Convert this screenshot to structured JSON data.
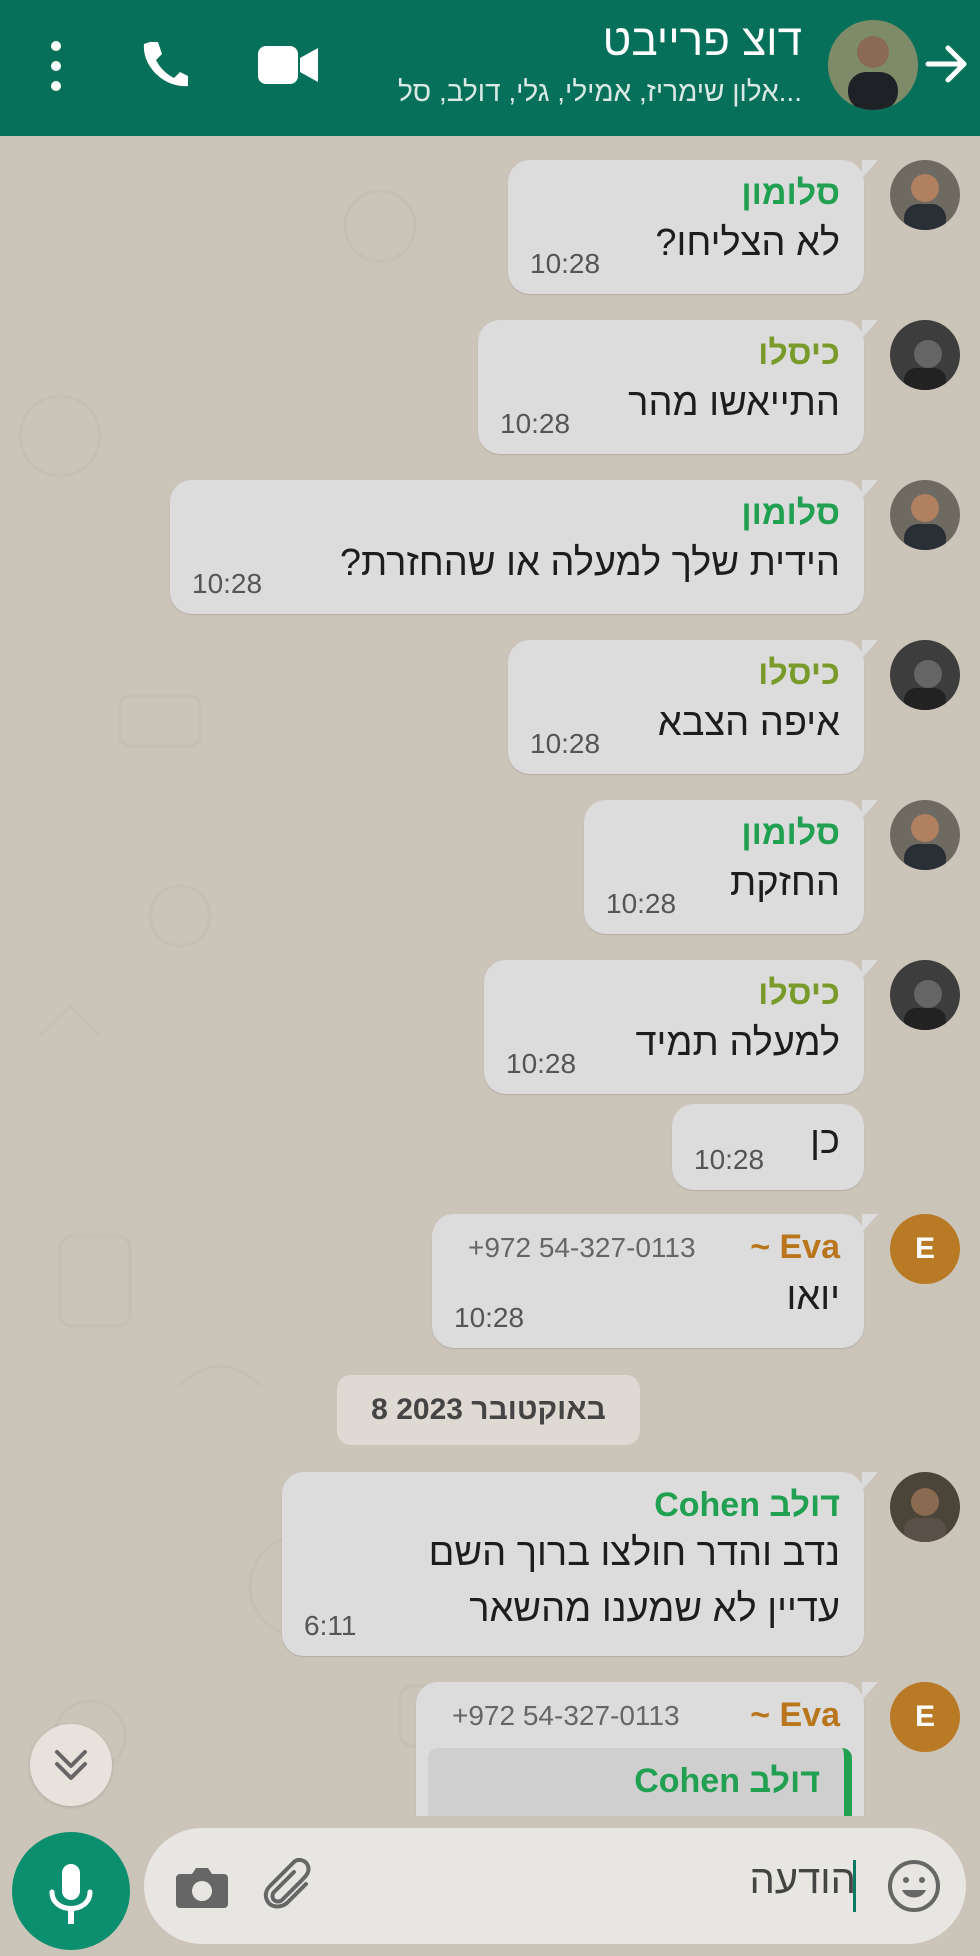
{
  "header": {
    "title": "דוצ פרייבט",
    "subtitle": "אלון שימריז, אמילי, גלי, דולב, סל..."
  },
  "messages": [
    {
      "sender": "סלומון",
      "text": "לא הצליחו?",
      "time": "10:28"
    },
    {
      "sender": "כיסלו",
      "text": "התייאשו מהר",
      "time": "10:28"
    },
    {
      "sender": "סלומון",
      "text": "הידית שלך למעלה או שהחזרת?",
      "time": "10:28"
    },
    {
      "sender": "כיסלו",
      "text": "איפה הצבא",
      "time": "10:28"
    },
    {
      "sender": "סלומון",
      "text": "החזקת",
      "time": "10:28"
    },
    {
      "sender": "כיסלו",
      "text": "למעלה תמיד",
      "time": "10:28"
    },
    {
      "sender": "",
      "text": "כן",
      "time": "10:28"
    },
    {
      "sender": "~ Eva",
      "phone": "+972 54-327-0113",
      "text": "יואו",
      "time": "10:28",
      "avatar_letter": "E"
    }
  ],
  "date_chip": "8 באוקטובר 2023",
  "message_dolev": {
    "sender": "דולב Cohen",
    "line1": "נדב והדר חולצו ברוך השם",
    "line2": "עדיין לא שמענו מהשאר",
    "time": "6:11"
  },
  "message_eva2": {
    "sender": "~ Eva",
    "phone": "+972 54-327-0113",
    "quote_sender": "דולב Cohen",
    "avatar_letter": "E"
  },
  "input": {
    "placeholder": "הודעה"
  },
  "colors": {
    "header_bg": "#07705a",
    "mic_bg": "#0c8f6e",
    "chat_bg": "#cbc4b9",
    "bubble_bg": "#dcdcdc"
  },
  "icons": [
    "back-arrow-icon",
    "video-call-icon",
    "phone-icon",
    "more-vert-icon",
    "mic-icon",
    "camera-icon",
    "attach-icon",
    "emoji-icon",
    "chevrons-down-icon"
  ]
}
